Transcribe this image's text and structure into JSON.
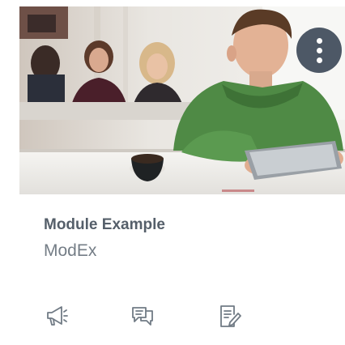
{
  "course_card": {
    "title": "Module Example",
    "subtitle": "ModEx",
    "options_icon": "more-vertical-icon",
    "options_color": "#4d5866",
    "actions": [
      {
        "icon": "announcements-icon"
      },
      {
        "icon": "discussions-icon"
      },
      {
        "icon": "assignments-icon"
      }
    ],
    "icon_color": "#717b85",
    "title_color": "#555f6a",
    "subtitle_color": "#747d86"
  }
}
